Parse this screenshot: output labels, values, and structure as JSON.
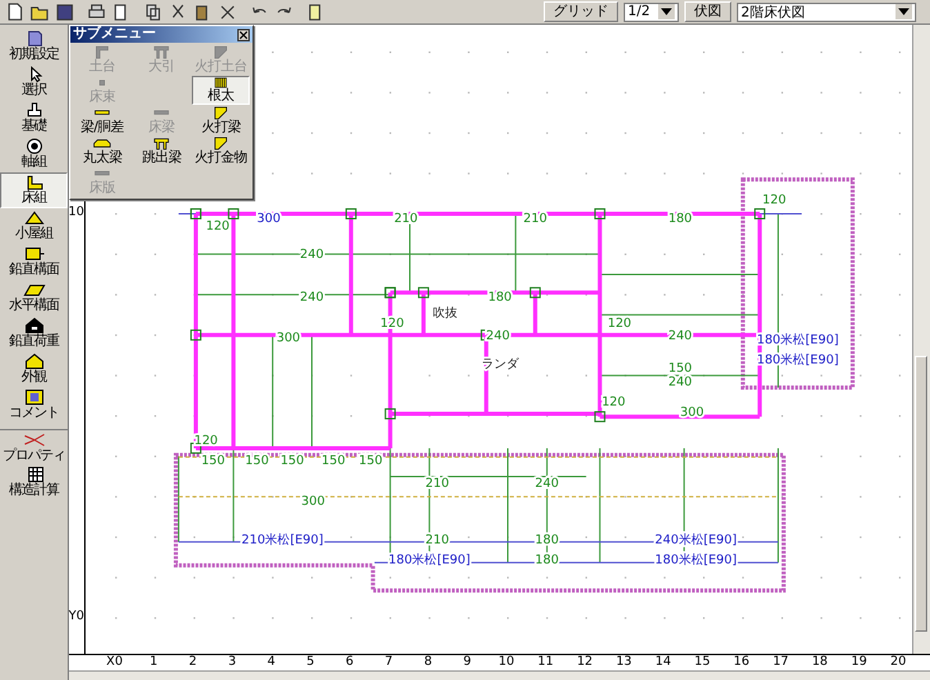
{
  "toolbar": {
    "grid_button": "グリッド",
    "scale": "1/2",
    "view_button": "伏図",
    "view_select": "2階床伏図"
  },
  "sidebar": [
    {
      "label": "初期設定",
      "selected": false
    },
    {
      "label": "選択",
      "selected": false
    },
    {
      "label": "基礎",
      "selected": false
    },
    {
      "label": "軸組",
      "selected": false
    },
    {
      "label": "床組",
      "selected": true
    },
    {
      "label": "小屋組",
      "selected": false
    },
    {
      "label": "鉛直構面",
      "selected": false
    },
    {
      "label": "水平構面",
      "selected": false
    },
    {
      "label": "鉛直荷重",
      "selected": false
    },
    {
      "label": "外観",
      "selected": false
    },
    {
      "label": "コメント",
      "selected": false
    },
    {
      "label": "プロパティ",
      "selected": false
    },
    {
      "label": "構造計算",
      "selected": false
    }
  ],
  "submenu": {
    "title": "サブメニュー",
    "items": [
      {
        "label": "土台",
        "disabled": true,
        "selected": false
      },
      {
        "label": "大引",
        "disabled": true,
        "selected": false
      },
      {
        "label": "火打土台",
        "disabled": true,
        "selected": false
      },
      {
        "label": "床束",
        "disabled": true,
        "selected": false
      },
      {
        "label": "根太",
        "disabled": false,
        "selected": true
      },
      {
        "label": "梁/胴差",
        "disabled": false,
        "selected": false
      },
      {
        "label": "床梁",
        "disabled": true,
        "selected": false
      },
      {
        "label": "火打梁",
        "disabled": false,
        "selected": false
      },
      {
        "label": "丸太梁",
        "disabled": false,
        "selected": false
      },
      {
        "label": "跳出梁",
        "disabled": false,
        "selected": false
      },
      {
        "label": "火打金物",
        "disabled": false,
        "selected": false
      },
      {
        "label": "床版",
        "disabled": true,
        "selected": false
      }
    ]
  },
  "canvas": {
    "y_axis": [
      "10",
      "Y0"
    ],
    "x_axis": [
      "X0",
      "1",
      "2",
      "3",
      "4",
      "5",
      "6",
      "7",
      "8",
      "9",
      "10",
      "11",
      "12",
      "13",
      "14",
      "15",
      "16",
      "17",
      "18",
      "19",
      "20"
    ],
    "labels": [
      {
        "text": "120",
        "kind": "dimension"
      },
      {
        "text": "300",
        "kind": "member"
      },
      {
        "text": "210",
        "kind": "dimension"
      },
      {
        "text": "210",
        "kind": "dimension"
      },
      {
        "text": "180",
        "kind": "dimension"
      },
      {
        "text": "120",
        "kind": "dimension"
      },
      {
        "text": "240",
        "kind": "dimension"
      },
      {
        "text": "240",
        "kind": "dimension"
      },
      {
        "text": "180",
        "kind": "dimension"
      },
      {
        "text": "吹抜",
        "kind": "room"
      },
      {
        "text": "120",
        "kind": "dimension"
      },
      {
        "text": "300",
        "kind": "dimension"
      },
      {
        "text": "240",
        "kind": "dimension"
      },
      {
        "text": "ランダ",
        "kind": "room"
      },
      {
        "text": "120",
        "kind": "dimension"
      },
      {
        "text": "240",
        "kind": "dimension"
      },
      {
        "text": "150",
        "kind": "dimension"
      },
      {
        "text": "240",
        "kind": "dimension"
      },
      {
        "text": "120",
        "kind": "dimension"
      },
      {
        "text": "150",
        "kind": "dimension"
      },
      {
        "text": "150",
        "kind": "dimension"
      },
      {
        "text": "150",
        "kind": "dimension"
      },
      {
        "text": "150",
        "kind": "dimension"
      },
      {
        "text": "150",
        "kind": "dimension"
      },
      {
        "text": "300",
        "kind": "dimension"
      },
      {
        "text": "210",
        "kind": "dimension"
      },
      {
        "text": "240",
        "kind": "dimension"
      },
      {
        "text": "210米松[E90]",
        "kind": "member"
      },
      {
        "text": "210",
        "kind": "dimension"
      },
      {
        "text": "180",
        "kind": "dimension"
      },
      {
        "text": "240米松[E90]",
        "kind": "member"
      },
      {
        "text": "180米松[E90]",
        "kind": "member"
      },
      {
        "text": "180",
        "kind": "dimension"
      },
      {
        "text": "180米松[E90]",
        "kind": "member"
      },
      {
        "text": "180米松[E90]",
        "kind": "member"
      },
      {
        "text": "180米松[E90]",
        "kind": "member"
      },
      {
        "text": "300",
        "kind": "dimension"
      },
      {
        "text": "120",
        "kind": "dimension"
      }
    ]
  }
}
